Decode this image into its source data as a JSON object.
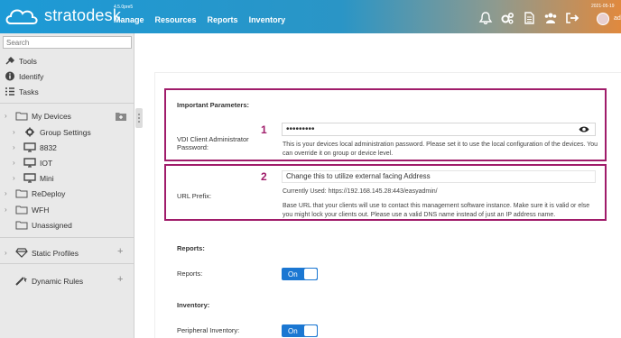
{
  "header": {
    "brand": "stratodesk",
    "version": "4.5.0pre5",
    "nav": [
      "Manage",
      "Resources",
      "Reports",
      "Inventory"
    ],
    "date": "2021-05-19",
    "username": "ad",
    "icons": [
      "bell-icon",
      "cogs-icon",
      "document-icon",
      "users-icon",
      "logout-icon",
      "avatar"
    ]
  },
  "sidebar": {
    "search_placeholder": "Search",
    "top_items": [
      "Tools",
      "Identify",
      "Tasks"
    ],
    "tree": {
      "my_devices": "My Devices",
      "group_settings": "Group Settings",
      "items": [
        "8832",
        "IOT",
        "Mini"
      ],
      "redeploy": "ReDeploy",
      "wfh": "WFH",
      "unassigned": "Unassigned"
    },
    "static_profiles": "Static Profiles",
    "dynamic_rules": "Dynamic Rules"
  },
  "main": {
    "important_parameters": "Important Parameters:",
    "vdi_label": "VDI Client Administrator Password:",
    "vdi_value": "•••••••••",
    "vdi_help": "This is your devices local administration password. Please set it to use the local configuration of the devices. You can override it on group or device level.",
    "callout_1": "1",
    "callout_2": "2",
    "url_label": "URL Prefix:",
    "url_value": "Change this to utilize external facing Address",
    "url_current": "Currently Used: https://192.168.145.28:443/easyadmin/",
    "url_help": "Base URL that your clients will use to contact this management software instance. Make sure it is valid or else you might lock your clients out. Please use a valid DNS name instead of just an IP address name.",
    "reports_section": "Reports:",
    "reports_label": "Reports:",
    "reports_toggle": "On",
    "inventory_section": "Inventory:",
    "peripheral_label": "Peripheral Inventory:",
    "peripheral_toggle": "On"
  },
  "colors": {
    "header_blue": "#1d9ad6",
    "header_orange": "#e0893e",
    "highlight": "#a01c6a",
    "toggle_blue": "#1b77d2"
  }
}
